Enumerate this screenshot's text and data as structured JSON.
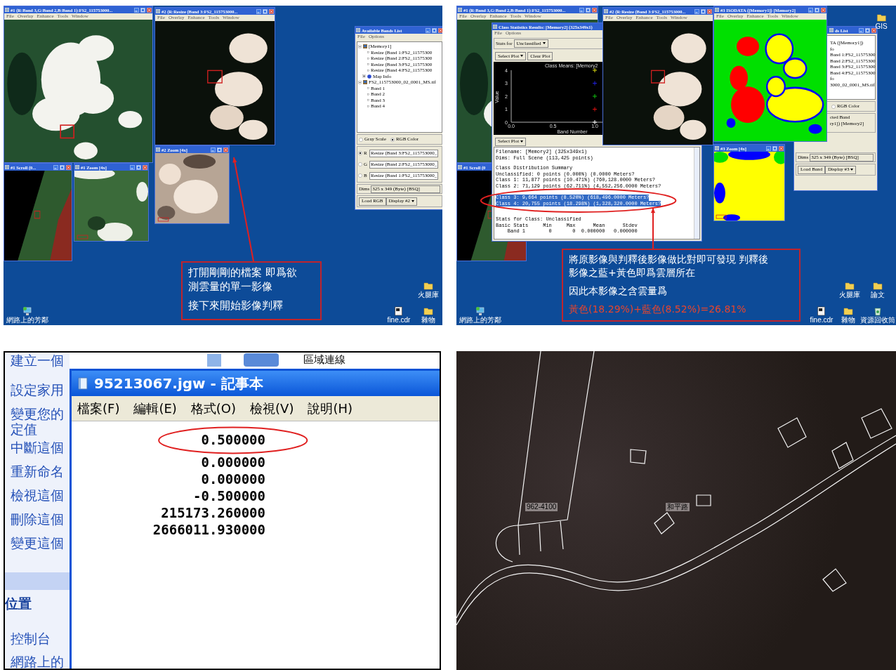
{
  "screen_1": {
    "windows": [
      {
        "kind": "image",
        "image": {
          "kind": "forest"
        },
        "title": "#1 (R:Band 3,G:Band 2,B:Band 1):FS2_115753000...",
        "title_buttons": true,
        "menu": [
          "File",
          "Overlay",
          "Enhance",
          "Tools",
          "Window"
        ]
      },
      {
        "kind": "image",
        "image": {
          "kind": "clouds"
        },
        "title": "#2 (R:Resize (Band 3:FS2_115753000...",
        "title_buttons": true,
        "menu": [
          "File",
          "Overlay",
          "Enhance",
          "Tools",
          "Window"
        ]
      },
      {
        "kind": "image",
        "image": {
          "kind": "coast"
        },
        "title": "#1 Scroll (0...",
        "title_buttons": true
      },
      {
        "kind": "image",
        "image": {
          "kind": "forest-zoom"
        },
        "title": "#1 Zoom [4x]",
        "title_buttons": true
      },
      {
        "kind": "image",
        "image": {
          "kind": "cloud-zoom"
        },
        "title": "#2 Zoom [4x]",
        "title_buttons": true
      },
      {
        "kind": "bands-list",
        "title": "Available Bands List",
        "title_buttons": true,
        "menu": [
          "File",
          "Options"
        ],
        "tree": [
          {
            "label": "[Memory1]",
            "kind": "memory",
            "expanded": true,
            "children": [
              {
                "label": "Resize (Band 1:FS2_11575300",
                "kind": "band"
              },
              {
                "label": "Resize (Band 2:FS2_11575300",
                "kind": "band"
              },
              {
                "label": "Resize (Band 3:FS2_11575300",
                "kind": "band"
              },
              {
                "label": "Resize (Band 4:FS2_11575300",
                "kind": "band"
              },
              {
                "label": "Map Info",
                "kind": "info",
                "expanded": false
              }
            ]
          },
          {
            "label": "FS2_115753000_02_0001_MS.tif",
            "kind": "memory",
            "expanded": true,
            "children": [
              {
                "label": "Band 1",
                "kind": "band"
              },
              {
                "label": "Band 2",
                "kind": "band"
              },
              {
                "label": "Band 3",
                "kind": "band"
              },
              {
                "label": "Band 4",
                "kind": "band"
              }
            ]
          }
        ],
        "modes": [
          {
            "label": "Gray Scale",
            "selected": false
          },
          {
            "label": "RGB Color",
            "selected": true
          }
        ],
        "channels": [
          {
            "label": "R",
            "selected": true,
            "band": "Resize (Band 3:FS2_115753000_"
          },
          {
            "label": "G",
            "selected": false,
            "band": "Resize (Band 2:FS2_115753000_"
          },
          {
            "label": "B",
            "selected": false,
            "band": "Resize (Band 1:FS2_115753000_"
          }
        ],
        "dims_label": "Dims",
        "dims": "325 x 349 (Byte) [BSQ]",
        "buttons": [
          {
            "label": "Load RGB",
            "kind": "button"
          },
          {
            "label": "Display #2",
            "kind": "dropdown"
          }
        ]
      }
    ],
    "callout": {
      "paragraphs": [
        {
          "kind": "plain",
          "lines": [
            "打開剛剛的檔案 即爲欲",
            "測雲量的單一影像"
          ]
        },
        {
          "kind": "plain",
          "lines": [
            "接下來開始影像判釋"
          ]
        }
      ]
    },
    "desktop_icons": [
      {
        "label": "火腿庫",
        "kind": "folder"
      },
      {
        "label": "網路上的芳鄰",
        "kind": "network"
      },
      {
        "label": "fine.cdr",
        "kind": "file"
      },
      {
        "label": "雜物",
        "kind": "folder"
      }
    ]
  },
  "screen_2": {
    "windows": [
      {
        "kind": "image",
        "image": {
          "kind": "forest"
        },
        "title": "#1 (R:Band 3,G:Band 2,B:Band 1):FS2_115753000...",
        "title_buttons": true,
        "menu": [
          "File",
          "Overlay",
          "Enhance",
          "Tools",
          "Window"
        ]
      },
      {
        "kind": "image",
        "image": {
          "kind": "coast"
        },
        "title": "#1 Scroll (0",
        "title_buttons": false
      },
      {
        "kind": "class-stats",
        "title": "Class Statistics Results: [Memory2] (325x349x1)",
        "title_buttons": false,
        "menu": [
          "File",
          "Options"
        ],
        "stats_for_label": "Stats for",
        "stats_for": "Unclassified",
        "plot_buttons": [
          {
            "label": "Select Plot",
            "kind": "dropdown"
          },
          {
            "label": "Clear Plot",
            "kind": "button"
          }
        ],
        "chart_data": {
          "type": "scatter",
          "title": "Class Means: [Memory2",
          "xlabel": "Band Number",
          "ylabel": "Value",
          "x": [
            1.0
          ],
          "series": [
            {
              "color": "#ffffff",
              "values": [
                0
              ]
            },
            {
              "color": "#e01010",
              "values": [
                1
              ]
            },
            {
              "color": "#10c010",
              "values": [
                2
              ]
            },
            {
              "color": "#2020e0",
              "values": [
                3
              ]
            },
            {
              "color": "#e0e010",
              "values": [
                4
              ]
            }
          ],
          "xlim": [
            0,
            2
          ],
          "ylim": [
            0,
            4
          ],
          "xticks": [
            {
              "value": 0,
              "label": "0.0"
            },
            {
              "value": 0.5,
              "label": "0.5"
            },
            {
              "value": 1,
              "label": "1.0"
            }
          ],
          "yticks": [
            0,
            1,
            2,
            3,
            4
          ]
        },
        "select_plot": "Select Plot",
        "report": [
          [
            {
              "text": "Filename: [Memory2] (325x349x1)",
              "selected": false
            },
            {
              "text": "Dims: Full Scene (113,425 points)",
              "selected": false
            }
          ],
          [
            {
              "text": "Class Distribution Summary",
              "selected": false
            },
            {
              "text": "Unclassified: 0 points (0.000%) (0.0000 Meters?",
              "selected": false
            },
            {
              "text": "Class 1: 11,877 points (10.471%) (760,128.0000 Meters?",
              "selected": false
            },
            {
              "text": "Class 2: 71,129 points (62.711%) (4,552,256.0000 Meters?",
              "selected": false
            },
            {
              "text": "Class 3: 9,664 points (8.520%) (618,496.0000 Meters?",
              "selected": true
            },
            {
              "text": "Class 4: 20,755 points (18.298%) (1,328,320.0000 Meters?",
              "selected": true
            }
          ],
          [
            {
              "text": "Stats for Class: Unclassified",
              "selected": false
            },
            {
              "text": "Basic Stats     Min     Max      Mean      Stdev",
              "selected": false
            },
            {
              "text": "    Band 1        0       0  0.000000   0.000000",
              "selected": false
            }
          ]
        ]
      },
      {
        "kind": "image",
        "image": {
          "kind": "clouds"
        },
        "title": "#2 (R:Resize (Band 3:FS2_115753000...",
        "title_buttons": true,
        "menu": [
          "File",
          "Overlay",
          "Enhance",
          "Tools",
          "Window"
        ]
      },
      {
        "kind": "bands-list-partial",
        "title": "ds List",
        "title_buttons": true,
        "lines": [
          "TA ([Memory1])",
          "fo",
          "Band 1:FS2_11575300",
          "Band 2:FS2_11575300",
          "Band 3:FS2_11575300",
          "Band 4:FS2_11575300",
          "fo",
          "3000_02_0001_MS.tif"
        ],
        "mode": {
          "label": "RGB Color",
          "selected": false
        },
        "band_header": "cted Band",
        "band_value": "ry1]) [Memory2]",
        "dims_label": "Dims",
        "dims": "325 x 349 (Byte) [BSQ]",
        "buttons": [
          {
            "label": "Load Band",
            "kind": "button"
          },
          {
            "label": "Display #3",
            "kind": "dropdown"
          }
        ]
      },
      {
        "kind": "image",
        "image": {
          "kind": "classified"
        },
        "title": "#3 ISODATA ([Memory1]) [Memory2]",
        "title_buttons": true,
        "menu": [
          "File",
          "Overlay",
          "Enhance",
          "Tools",
          "Window"
        ]
      },
      {
        "kind": "image",
        "image": {
          "kind": "classified-zoom"
        },
        "title": "#3 Zoom [4x]",
        "title_buttons": true
      }
    ],
    "callout": {
      "paragraphs": [
        {
          "kind": "plain",
          "lines": [
            "將原影像與判釋後影像做比對即可發現 判釋後",
            "影像之藍+黃色即爲雲層所在"
          ]
        },
        {
          "kind": "plain",
          "lines": [
            "因此本影像之含雲量爲"
          ]
        },
        {
          "kind": "result",
          "lines": [
            "黃色(18.29%)+藍色(8.52%)=26.81%"
          ]
        }
      ]
    },
    "desktop_icons": [
      {
        "label": "GIS",
        "kind": "folder"
      },
      {
        "label": "火腿庫",
        "kind": "folder"
      },
      {
        "label": "論文",
        "kind": "folder"
      },
      {
        "label": "網路上的芳鄰",
        "kind": "network"
      },
      {
        "label": "fine.cdr",
        "kind": "file"
      },
      {
        "label": "雜物",
        "kind": "folder"
      },
      {
        "label": "資源回收筒",
        "kind": "recycle"
      }
    ]
  },
  "screen_3": {
    "background_label": "區域連線",
    "tasks": [
      "建立一個",
      "設定家用",
      "變更您的",
      "定值",
      "中斷這個",
      "重新命名",
      "檢視這個",
      "刪除這個",
      "變更這個"
    ],
    "other_places_header": "位置",
    "other_places": [
      "控制台",
      "網路上的"
    ],
    "notepad": {
      "title": "95213067.jgw - 記事本",
      "menu": [
        "檔案(F)",
        "編輯(E)",
        "格式(O)",
        "檢視(V)",
        "說明(H)"
      ],
      "lines": [
        {
          "text": "0.500000",
          "circled": true
        },
        {
          "text": "0.000000",
          "circled": false
        },
        {
          "text": "0.000000",
          "circled": false
        },
        {
          "text": "-0.500000",
          "circled": false
        },
        {
          "text": "215173.260000",
          "circled": false
        },
        {
          "text": "2666011.930000",
          "circled": false
        }
      ]
    }
  },
  "screen_4": {
    "map_labels": [
      "962-4100",
      "和平路"
    ]
  }
}
